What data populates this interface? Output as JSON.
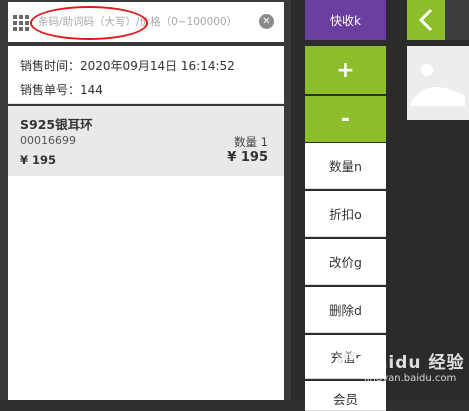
{
  "search": {
    "placeholder": "条码/助词码（大写）/价格（0~100000）"
  },
  "sale_info": {
    "time_label": "销售时间：",
    "time_value": "2020年09月14日 16:14:52",
    "number_label": "销售单号：",
    "number_value": "144"
  },
  "items": [
    {
      "name": "S925银耳环",
      "code": "00016699",
      "qty_label": "数量",
      "qty": "1",
      "price": "¥ 195",
      "total": "¥ 195"
    }
  ],
  "buttons": {
    "quick_checkout": "快收k",
    "plus": "+",
    "minus": "-",
    "quantity": "数量n",
    "discount": "折扣o",
    "change_price": "改价g",
    "delete": "删除d",
    "recharge": "充值r",
    "member": "会员"
  },
  "watermark": {
    "brand": "Baidu 经验",
    "sub": "jingyan.baidu.com"
  },
  "colors": {
    "accent_green": "#8cbd2a",
    "accent_purple": "#6b3fa0",
    "annotation_red": "#e01818"
  }
}
